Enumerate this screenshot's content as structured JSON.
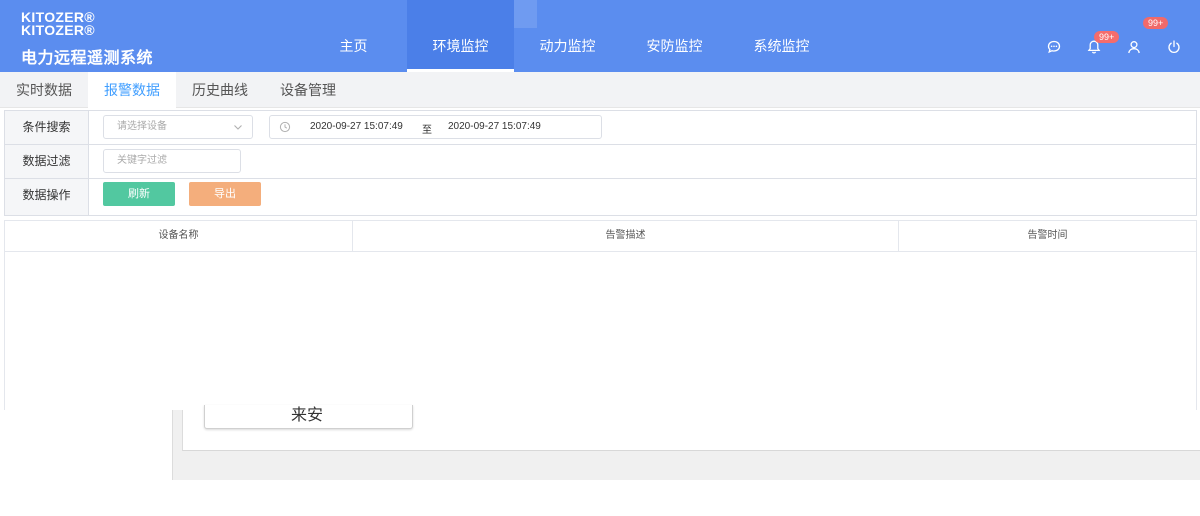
{
  "header": {
    "brand_en_1": "KITOZER®",
    "brand_en_2": "KITOZER®",
    "brand_cn": "电力远程遥测系统",
    "nav": [
      {
        "label": "主页",
        "active": false
      },
      {
        "label": "环境监控",
        "active": true
      },
      {
        "label": "动力监控",
        "active": false
      },
      {
        "label": "安防监控",
        "active": false
      },
      {
        "label": "系统监控",
        "active": false
      }
    ],
    "badge_ghost": "99+",
    "badge_bell": "99+",
    "icons": [
      "chat-icon",
      "bell-icon",
      "user-icon",
      "power-icon"
    ],
    "color": "#5b8def"
  },
  "subtabs": [
    {
      "label": "实时数据",
      "active": false
    },
    {
      "label": "报警数据",
      "active": true
    },
    {
      "label": "历史曲线",
      "active": false
    },
    {
      "label": "设备管理",
      "active": false
    }
  ],
  "filter": {
    "search_label": "条件搜索",
    "device_placeholder": "请选择设备",
    "date_start": "2020-09-27 15:07:49",
    "date_sep": "至",
    "date_end": "2020-09-27 15:07:49",
    "filter_label": "数据过滤",
    "keyword_placeholder": "关键字过滤",
    "ops_label": "数据操作",
    "refresh": "刷新",
    "export": "导出"
  },
  "table": {
    "columns": [
      "设备名称",
      "告警描述",
      "告警时间"
    ],
    "rows": []
  },
  "overlay": {
    "button_fragment": "来安"
  }
}
